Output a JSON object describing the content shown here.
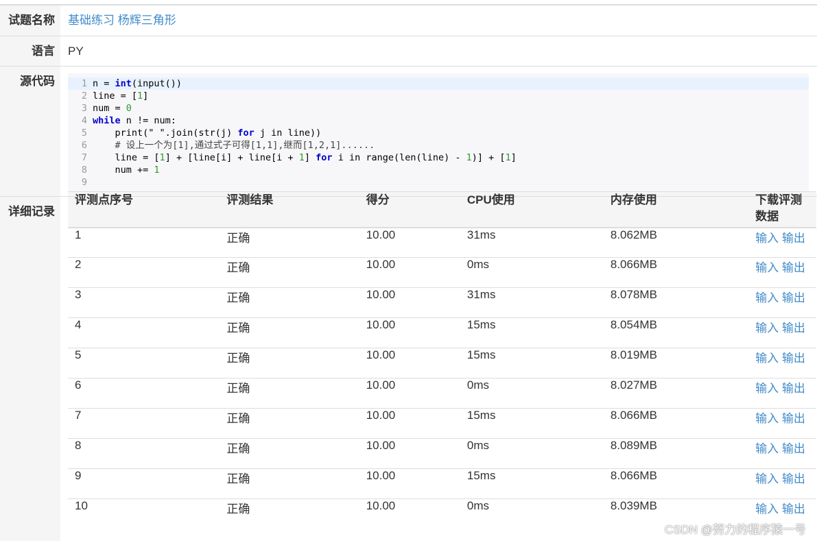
{
  "info": {
    "title_label": "试题名称",
    "title_value": "基础练习 杨辉三角形",
    "lang_label": "语言",
    "lang_value": "PY",
    "code_label": "源代码",
    "detail_label": "详细记录"
  },
  "code": {
    "lines": [
      [
        {
          "t": "n = ",
          "c": "ct"
        },
        {
          "t": "int",
          "c": "kw"
        },
        {
          "t": "(input())",
          "c": "ct"
        }
      ],
      [
        {
          "t": "line = [",
          "c": "ct"
        },
        {
          "t": "1",
          "c": "num"
        },
        {
          "t": "]",
          "c": "ct"
        }
      ],
      [
        {
          "t": "num = ",
          "c": "ct"
        },
        {
          "t": "0",
          "c": "num"
        }
      ],
      [
        {
          "t": "while",
          "c": "kw"
        },
        {
          "t": " n != num:",
          "c": "ct"
        }
      ],
      [
        {
          "t": "    print(\" \".join(str(j) ",
          "c": "ct"
        },
        {
          "t": "for",
          "c": "kw"
        },
        {
          "t": " j in line))",
          "c": "ct"
        }
      ],
      [
        {
          "t": "    # 设上一个为[1],通过式子可得[1,1],继而[1,2,1]......",
          "c": "cm"
        }
      ],
      [
        {
          "t": "    line = [",
          "c": "ct"
        },
        {
          "t": "1",
          "c": "num"
        },
        {
          "t": "] + [line[i] + line[i + ",
          "c": "ct"
        },
        {
          "t": "1",
          "c": "num"
        },
        {
          "t": "] ",
          "c": "ct"
        },
        {
          "t": "for",
          "c": "kw"
        },
        {
          "t": " i in range(len(line) - ",
          "c": "ct"
        },
        {
          "t": "1",
          "c": "num"
        },
        {
          "t": ")] + [",
          "c": "ct"
        },
        {
          "t": "1",
          "c": "num"
        },
        {
          "t": "]",
          "c": "ct"
        }
      ],
      [
        {
          "t": "    num += ",
          "c": "ct"
        },
        {
          "t": "1",
          "c": "num"
        }
      ],
      []
    ],
    "highlighted_line": 1
  },
  "details": {
    "headers": [
      "评测点序号",
      "评测结果",
      "得分",
      "CPU使用",
      "内存使用",
      "下载评测数据"
    ],
    "input_label": "输入",
    "output_label": "输出",
    "rows": [
      {
        "no": "1",
        "result": "正确",
        "score": "10.00",
        "cpu": "31ms",
        "mem": "8.062MB"
      },
      {
        "no": "2",
        "result": "正确",
        "score": "10.00",
        "cpu": "0ms",
        "mem": "8.066MB"
      },
      {
        "no": "3",
        "result": "正确",
        "score": "10.00",
        "cpu": "31ms",
        "mem": "8.078MB"
      },
      {
        "no": "4",
        "result": "正确",
        "score": "10.00",
        "cpu": "15ms",
        "mem": "8.054MB"
      },
      {
        "no": "5",
        "result": "正确",
        "score": "10.00",
        "cpu": "15ms",
        "mem": "8.019MB"
      },
      {
        "no": "6",
        "result": "正确",
        "score": "10.00",
        "cpu": "0ms",
        "mem": "8.027MB"
      },
      {
        "no": "7",
        "result": "正确",
        "score": "10.00",
        "cpu": "15ms",
        "mem": "8.066MB"
      },
      {
        "no": "8",
        "result": "正确",
        "score": "10.00",
        "cpu": "0ms",
        "mem": "8.089MB"
      },
      {
        "no": "9",
        "result": "正确",
        "score": "10.00",
        "cpu": "15ms",
        "mem": "8.066MB"
      },
      {
        "no": "10",
        "result": "正确",
        "score": "10.00",
        "cpu": "0ms",
        "mem": "8.039MB"
      }
    ]
  },
  "watermark": "CSDN @努力的程序猿一号",
  "colors": {
    "link": "#428bca",
    "keyword": "#0000cc",
    "number": "#2a9d2a",
    "label_bg": "#f5f5f5"
  }
}
